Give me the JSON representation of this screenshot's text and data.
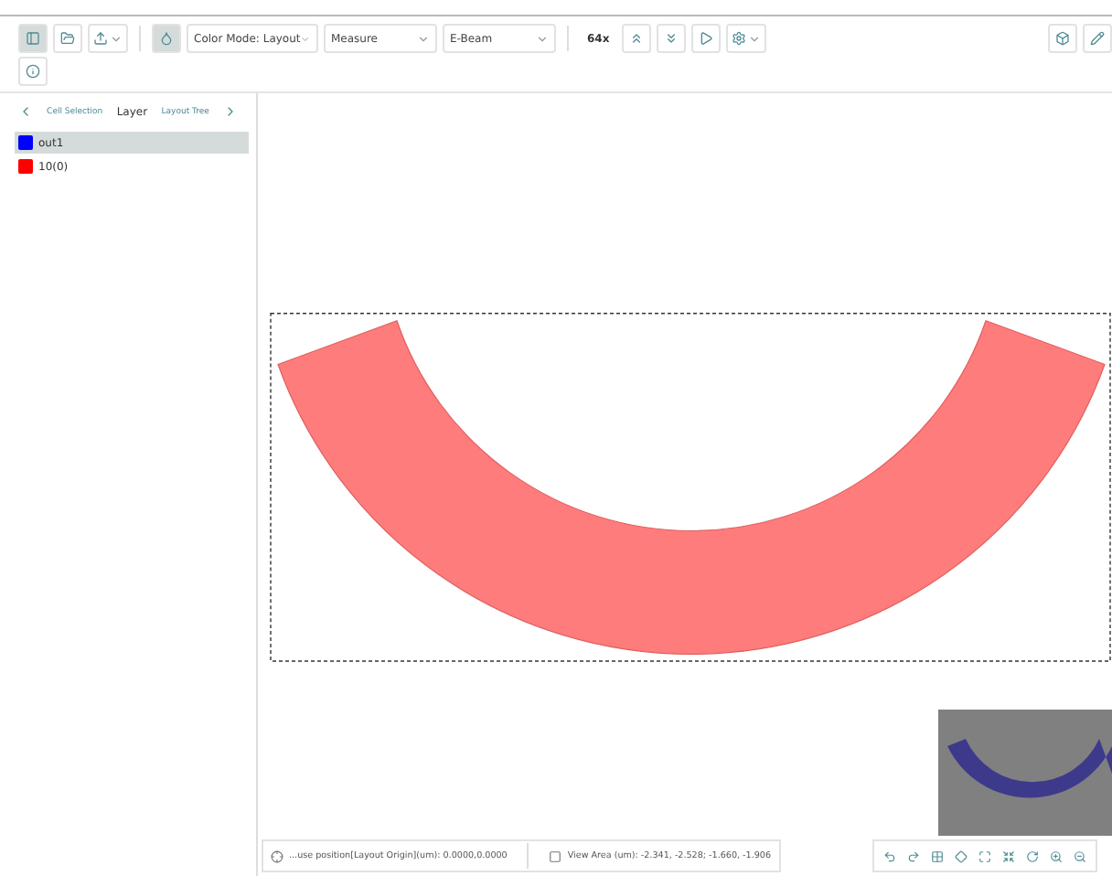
{
  "toolbar": {
    "left_buttons": [
      {
        "kind": "panel",
        "selected": true
      },
      {
        "kind": "folder",
        "selected": false
      },
      {
        "kind": "export",
        "selected": false,
        "caret": true
      },
      {
        "kind": "droplet",
        "selected": true
      }
    ],
    "dropdowns": [
      {
        "label": "Color Mode: Layout"
      },
      {
        "label": "Measure"
      },
      {
        "label": "E-Beam"
      }
    ],
    "zoom": "64x",
    "nav_buttons": [
      {
        "kind": "up"
      },
      {
        "kind": "down"
      },
      {
        "kind": "play"
      },
      {
        "kind": "gear",
        "caret": true
      }
    ],
    "right_buttons": [
      {
        "kind": "box"
      },
      {
        "kind": "pencil"
      }
    ],
    "second_row": [
      {
        "kind": "info"
      }
    ]
  },
  "panel": {
    "tabs": [
      {
        "label": "Cell Selection",
        "selected": false
      },
      {
        "label": "Layer",
        "selected": true
      },
      {
        "label": "Layout Tree",
        "selected": false
      }
    ],
    "layers": [
      {
        "name": "out1",
        "color": "#0000ff",
        "selected": true
      },
      {
        "name": "10(0)",
        "color": "#ff0000",
        "selected": false
      }
    ]
  },
  "status_bar": {
    "position": "...use position[Layout Origin](um): 0.0000,0.0000",
    "view_area": "View Area (um): -2.341, -2.528; -1.660, -1.906"
  }
}
